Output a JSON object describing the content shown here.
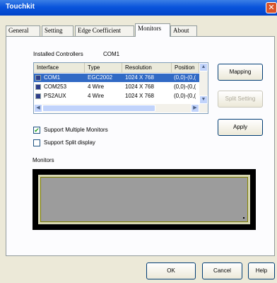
{
  "window": {
    "title": "Touchkit",
    "close_glyph": "✕"
  },
  "tabs": [
    {
      "label": "General"
    },
    {
      "label": "Setting"
    },
    {
      "label": "Edge Coefficient"
    },
    {
      "label": "Monitors"
    },
    {
      "label": "About"
    }
  ],
  "installed": {
    "label": "Installed Controllers",
    "current": "COM1"
  },
  "listview": {
    "columns": [
      "Interface",
      "Type",
      "Resolution",
      "Position"
    ],
    "rows": [
      {
        "interface": "COM1",
        "type": "EGC2002",
        "resolution": "1024 X 768",
        "position": "(0,0)-(0,(",
        "selected": true
      },
      {
        "interface": "COM253",
        "type": "4 Wire",
        "resolution": "1024 X 768",
        "position": "(0,0)-(0,(",
        "selected": false
      },
      {
        "interface": "PS2AUX",
        "type": "4 Wire",
        "resolution": "1024 X 768",
        "position": "(0,0)-(0,(",
        "selected": false
      }
    ]
  },
  "buttons": {
    "mapping": "Mapping",
    "split_setting": "Split Setting",
    "apply": "Apply",
    "ok": "OK",
    "cancel": "Cancel",
    "help": "Help"
  },
  "checkboxes": {
    "multiple_monitors": {
      "label": "Support Multiple Monitors",
      "checked": true,
      "mark": "✔"
    },
    "split_display": {
      "label": "Support Split display",
      "checked": false
    }
  },
  "monitors_label": "Monitors",
  "icons": {
    "scroll_up": "▲",
    "scroll_down": "▼",
    "scroll_left": "◀",
    "scroll_right": "▶"
  },
  "colors": {
    "title_bar": "#0a55dc",
    "selection": "#316ac5",
    "monitor_frame": "#000000",
    "monitor_inner": "#9c9c9c"
  }
}
